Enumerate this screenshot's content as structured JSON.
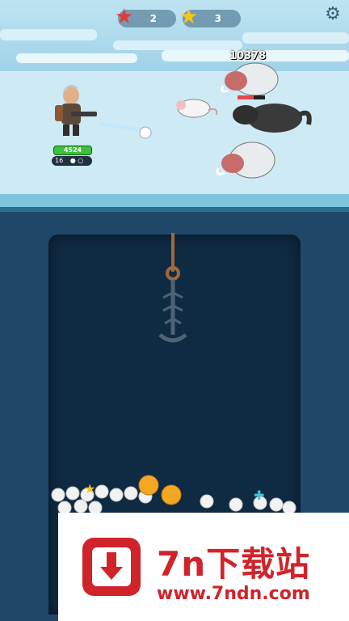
{
  "hud": {
    "red_star_count": "2",
    "yellow_star_count": "3",
    "red_star_icon": "red-star-icon",
    "yellow_star_icon": "yellow-star-icon",
    "settings_icon": "gear-icon"
  },
  "hero": {
    "hp": "4524",
    "ammo": "16"
  },
  "enemies": {
    "damage_text": "10378"
  },
  "banner": {
    "brand": "7n下载站",
    "url": "www.7ndn.com",
    "accent": "#d0232a"
  }
}
